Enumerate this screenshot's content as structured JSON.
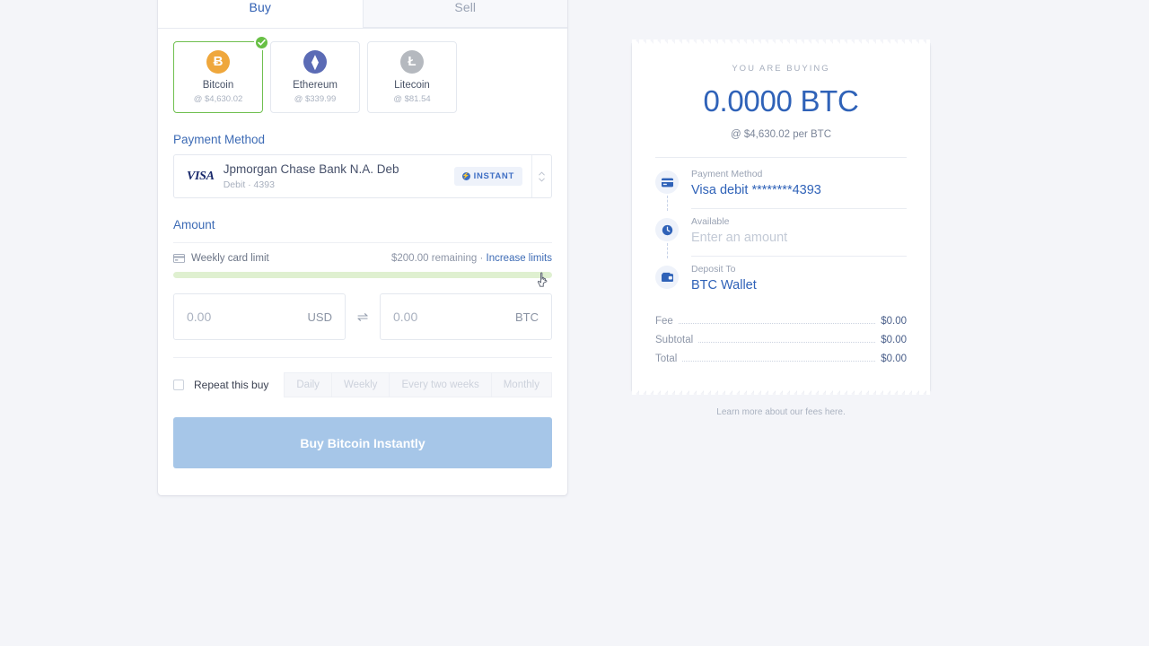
{
  "tabs": [
    {
      "label": "Buy",
      "active": true
    },
    {
      "label": "Sell",
      "active": false
    }
  ],
  "coins": [
    {
      "name": "Bitcoin",
      "price": "@ $4,630.02",
      "symbol": "Ƀ",
      "color": "#efa73c",
      "selected": true
    },
    {
      "name": "Ethereum",
      "price": "@ $339.99",
      "symbol": "⧫",
      "color": "#5b6bb5",
      "selected": false
    },
    {
      "name": "Litecoin",
      "price": "@ $81.54",
      "symbol": "Ł",
      "color": "#b5b9bf",
      "selected": false
    }
  ],
  "payment_section": {
    "title": "Payment Method",
    "brand": "VISA",
    "bank": "Jpmorgan Chase Bank N.A. Deb",
    "details": "Debit · 4393",
    "badge": "INSTANT"
  },
  "amount_section": {
    "title": "Amount",
    "limit_label": "Weekly card limit",
    "limit_remaining": "$200.00 remaining",
    "limit_separator": "·",
    "increase_link": "Increase limits",
    "fiat_placeholder": "0.00",
    "fiat_currency": "USD",
    "crypto_placeholder": "0.00",
    "crypto_currency": "BTC",
    "swap_icon": "⇌"
  },
  "repeat": {
    "label": "Repeat this buy",
    "options": [
      "Daily",
      "Weekly",
      "Every two weeks",
      "Monthly"
    ]
  },
  "submit": {
    "label": "Buy Bitcoin Instantly"
  },
  "receipt": {
    "eyebrow": "YOU ARE BUYING",
    "amount": "0.0000 BTC",
    "rate": "@ $4,630.02 per BTC",
    "steps": [
      {
        "label": "Payment Method",
        "value": "Visa debit ********4393",
        "icon": "credit-card-icon",
        "muted": false
      },
      {
        "label": "Available",
        "value": "Enter an amount",
        "icon": "clock-icon",
        "muted": true
      },
      {
        "label": "Deposit To",
        "value": "BTC Wallet",
        "icon": "wallet-icon",
        "muted": false
      }
    ],
    "fees": [
      {
        "label": "Fee",
        "value": "$0.00"
      },
      {
        "label": "Subtotal",
        "value": "$0.00"
      },
      {
        "label": "Total",
        "value": "$0.00"
      }
    ],
    "note_prefix": "Learn more about our fees ",
    "note_link": "here",
    "note_suffix": "."
  },
  "colors": {
    "accent_blue": "#2f62b8",
    "link_blue": "#3d6bb5",
    "selected_green": "#68c045",
    "progress_green": "#dff0d0",
    "button_blue": "#a6c6e8",
    "page_bg": "#f4f5f9"
  }
}
